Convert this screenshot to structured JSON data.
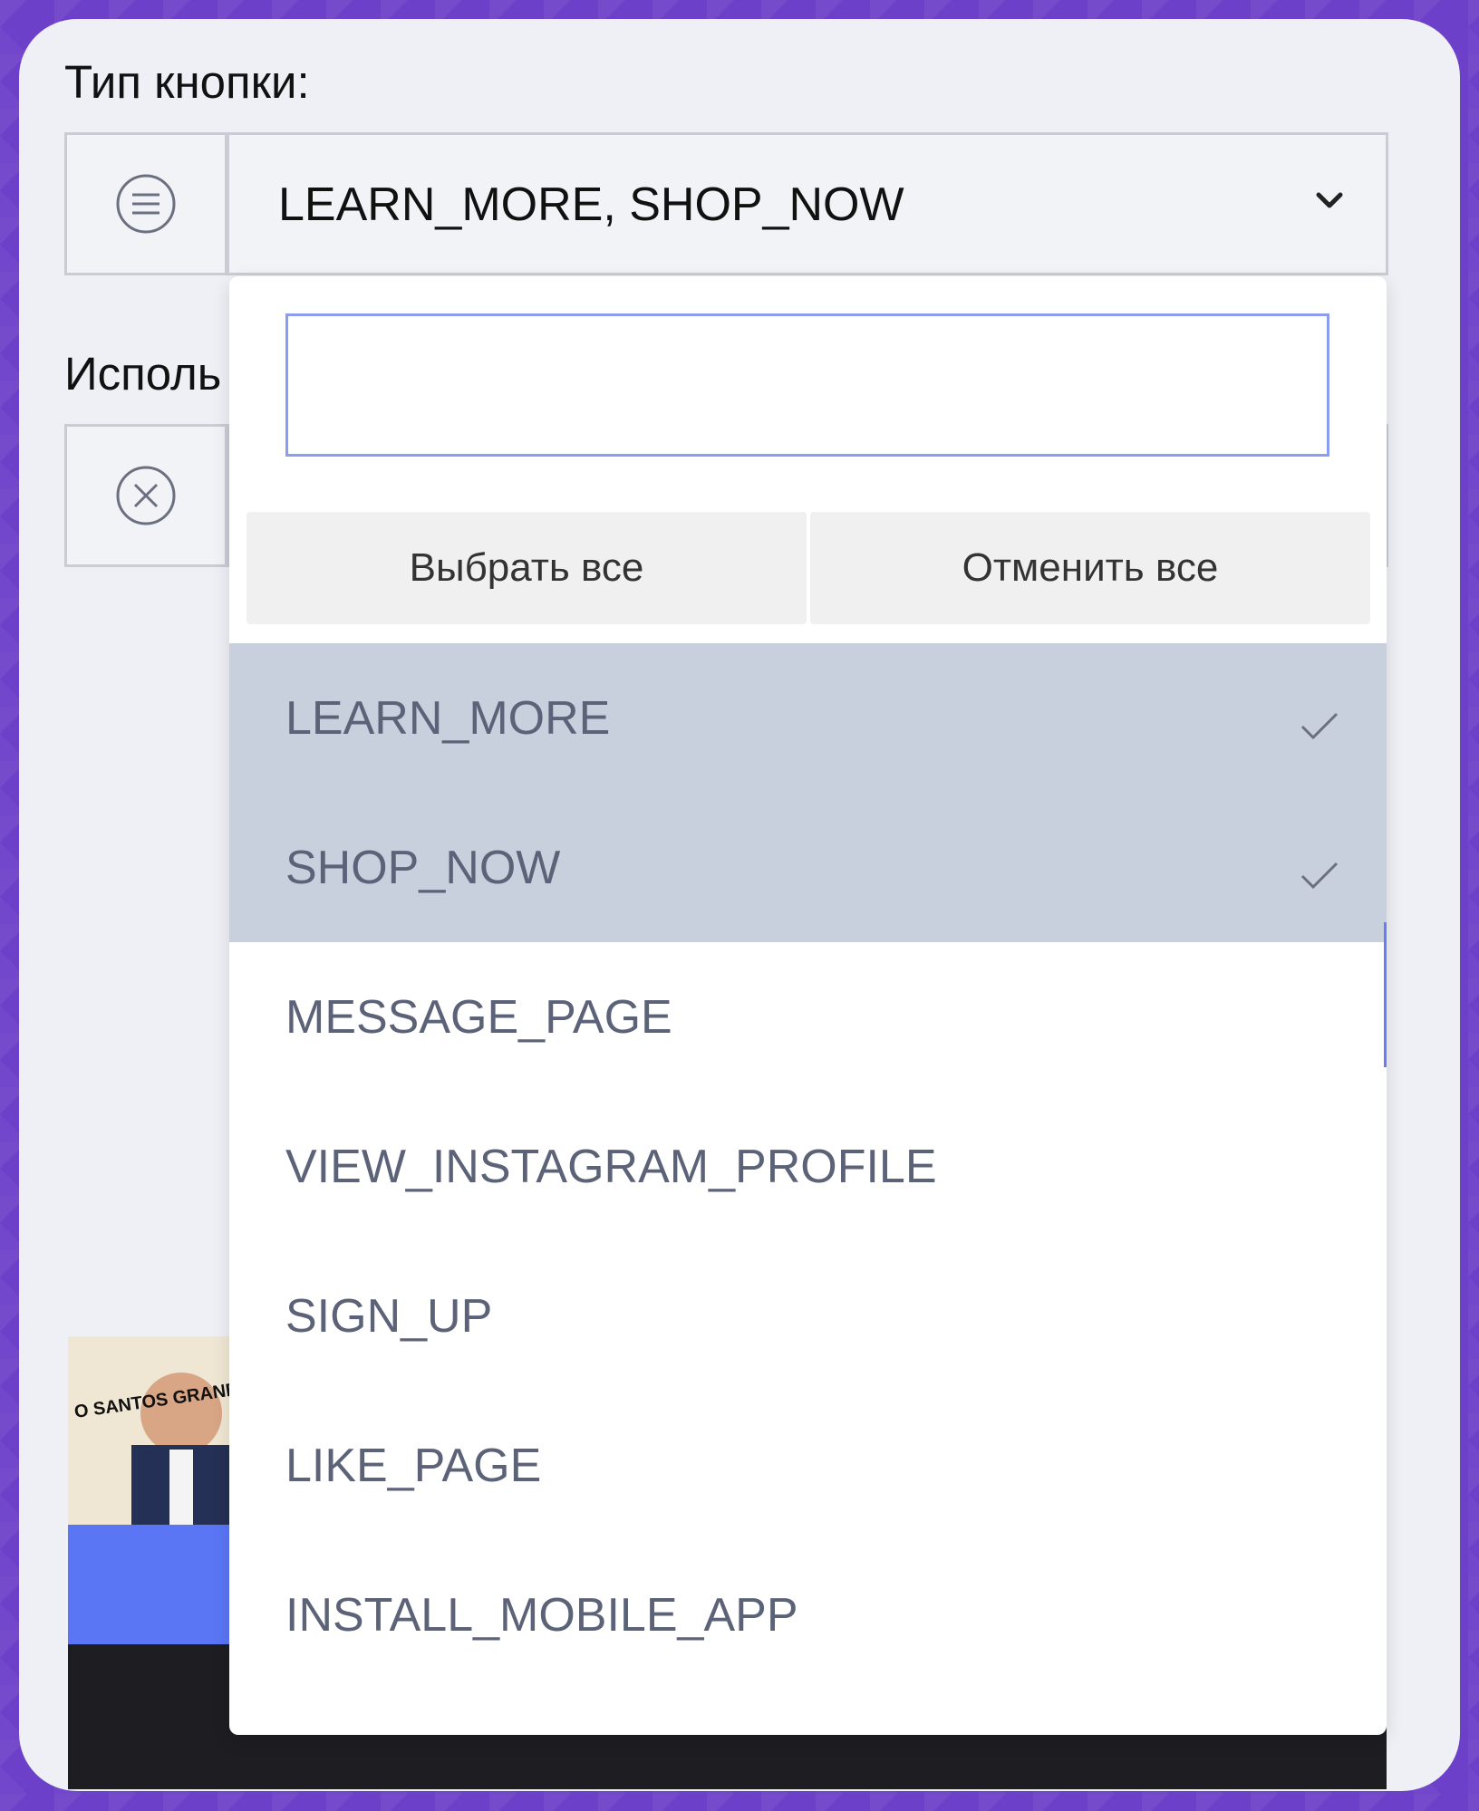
{
  "button_type": {
    "label": "Тип кнопки:",
    "selected_value": "LEARN_MORE, SHOP_NOW"
  },
  "second_field": {
    "label_partial": "Исполь"
  },
  "dropdown": {
    "search_placeholder": "",
    "select_all": "Выбрать все",
    "deselect_all": "Отменить все",
    "options": [
      {
        "label": "LEARN_MORE",
        "selected": true
      },
      {
        "label": "SHOP_NOW",
        "selected": true
      },
      {
        "label": "MESSAGE_PAGE",
        "selected": false
      },
      {
        "label": "VIEW_INSTAGRAM_PROFILE",
        "selected": false
      },
      {
        "label": "SIGN_UP",
        "selected": false
      },
      {
        "label": "LIKE_PAGE",
        "selected": false
      },
      {
        "label": "INSTALL_MOBILE_APP",
        "selected": false
      }
    ]
  },
  "thumbnail": {
    "caption": "O SANTOS GRANDE DE NOVO"
  },
  "colors": {
    "frame": "#6c40c9",
    "selected_row": "#c8cfdd",
    "input_focus": "#8c9cf0",
    "accent_blue": "#5b76f5"
  }
}
